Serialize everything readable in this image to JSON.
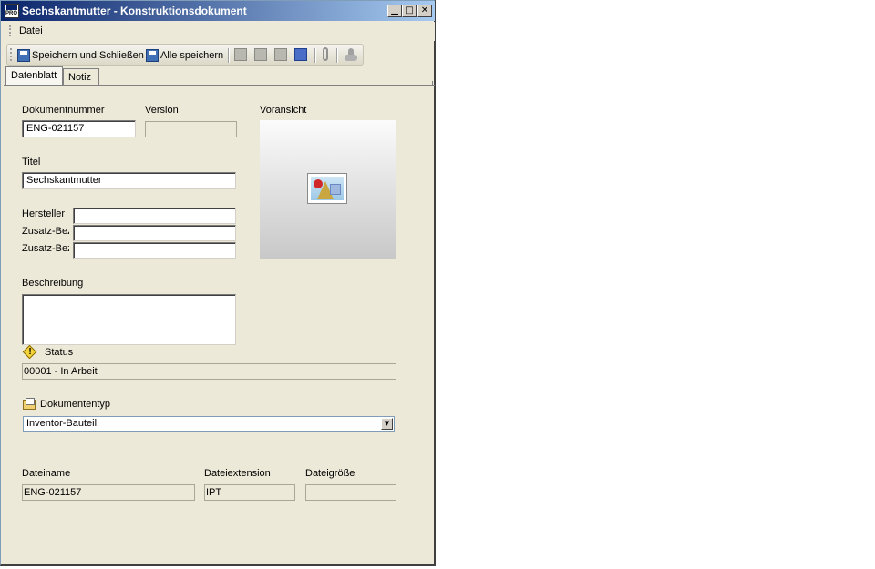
{
  "window": {
    "title": "Sechskantmutter - Konstruktionsdokument",
    "app_icon_label": "PRO"
  },
  "window_buttons": {
    "minimize": "▁",
    "maximize": "□",
    "close": "✕"
  },
  "menu": {
    "items": [
      "Datei"
    ]
  },
  "toolbar": {
    "save_close_label": "Speichern und Schließen",
    "save_all_label": "Alle speichern"
  },
  "tabs": [
    {
      "label": "Datenblatt",
      "active": true
    },
    {
      "label": "Notiz",
      "active": false
    }
  ],
  "form": {
    "document_number_label": "Dokumentnummer",
    "document_number_value": "ENG-021157",
    "version_label": "Version",
    "version_value": "",
    "preview_label": "Voransicht",
    "title_label": "Titel",
    "title_value": "Sechskantmutter",
    "manufacturer_label": "Hersteller",
    "manufacturer_value": "",
    "extra1_label": "Zusatz-Bez",
    "extra1_value": "",
    "extra2_label": "Zusatz-Bez",
    "extra2_value": "",
    "description_label": "Beschreibung",
    "description_value": "",
    "status_label": "Status",
    "status_value": "00001 - In Arbeit",
    "doctype_label": "Dokumententyp",
    "doctype_value": "Inventor-Bauteil",
    "filename_label": "Dateiname",
    "filename_value": "ENG-021157",
    "extension_label": "Dateiextension",
    "extension_value": "IPT",
    "filesize_label": "Dateigröße",
    "filesize_value": ""
  }
}
